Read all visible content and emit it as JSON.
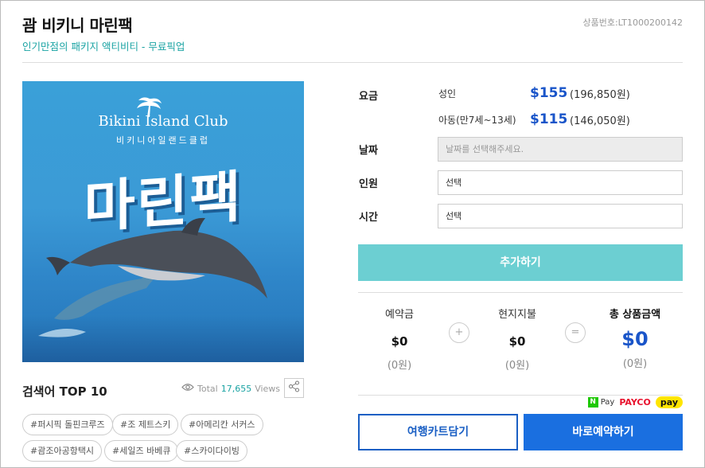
{
  "product": {
    "title": "괌 비키니 마린팩",
    "code": "상품번호:LT1000200142",
    "subtitle": "인기만점의 패키지 액티비티 - 무료픽업"
  },
  "hero": {
    "logo_text": "Bikini Island Club",
    "logo_sub": "비키니아일랜드클럽",
    "headline": "마린팩"
  },
  "search_top": {
    "title": "검색어 TOP 10",
    "views_label": "Total",
    "views_count": "17,655",
    "views_unit": "Views",
    "tags": [
      "#퍼시픽 돌핀크루즈",
      "#조 제트스키",
      "#아메리칸 서커스",
      "#괌조아공항택시",
      "#세일즈 바베큐",
      "#스카이다이빙"
    ]
  },
  "booking": {
    "price_label": "요금",
    "adult_label": "성인",
    "adult_usd": "$155",
    "adult_krw": "(196,850원)",
    "child_label": "아동(만7세~13세)",
    "child_usd": "$115",
    "child_krw": "(146,050원)",
    "date_label": "날짜",
    "date_placeholder": "날짜를 선택해주세요.",
    "people_label": "인원",
    "people_value": "선택",
    "time_label": "시간",
    "time_value": "선택",
    "add_button": "추가하기"
  },
  "summary": {
    "deposit_label": "예약금",
    "deposit_usd": "$0",
    "deposit_krw": "(0원)",
    "plus": "+",
    "local_label": "현지지불",
    "local_usd": "$0",
    "local_krw": "(0원)",
    "equals": "=",
    "total_label": "총 상품금액",
    "total_usd": "$0",
    "total_krw": "(0원)"
  },
  "payments": {
    "npay": "Pay",
    "npay_mark": "N",
    "payco": "PAYCO",
    "kpay": "pay"
  },
  "actions": {
    "cart": "여행카트담기",
    "book": "바로예약하기"
  },
  "colors": {
    "accent": "#1a55c9",
    "teal": "#1aa3a3",
    "add_button": "#6ccfd2",
    "book_button": "#1a6fe0"
  }
}
